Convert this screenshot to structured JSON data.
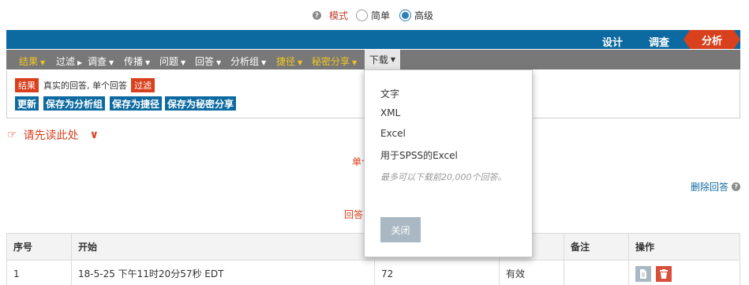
{
  "mode": {
    "label": "模式",
    "options": [
      "简单",
      "高级"
    ],
    "selected": "高级"
  },
  "topnav": {
    "items": [
      "设计",
      "调查",
      "分析"
    ],
    "active": "分析",
    "active_color": "#d8401e",
    "bar_color": "#0d6aa0"
  },
  "toolbar": {
    "results": "结果",
    "filter": "过滤",
    "survey": "调查",
    "campaign": "传播",
    "question": "问题",
    "answer": "回答",
    "analysis_group": "分析组",
    "shortcut": "捷径",
    "secret_share": "秘密分享",
    "download": "下载"
  },
  "filter_panel": {
    "results_tag": "结果",
    "description": "真实的回答, 单个回答",
    "filter_tag": "过滤",
    "buttons": {
      "update": "更新",
      "save_group": "保存为分析组",
      "save_shortcut": "保存为捷径",
      "save_secret": "保存为秘密分享"
    }
  },
  "read_first": "请先读此处",
  "partial_1": "单个",
  "partial_2": "回答",
  "delete_responses": "删除回答",
  "table": {
    "headers": {
      "seq": "序号",
      "start": "开始",
      "notes": "备注",
      "actions": "操作"
    },
    "rows": [
      {
        "seq": "1",
        "start": "18-5-25 下午11时20分57秒 EDT",
        "value": "72",
        "status": "有效",
        "notes": ""
      }
    ]
  },
  "download_menu": {
    "items": [
      "文字",
      "XML",
      "Excel",
      "用于SPSS的Excel"
    ],
    "note": "最多可以下载前20,000个回答。",
    "close": "关闭"
  }
}
